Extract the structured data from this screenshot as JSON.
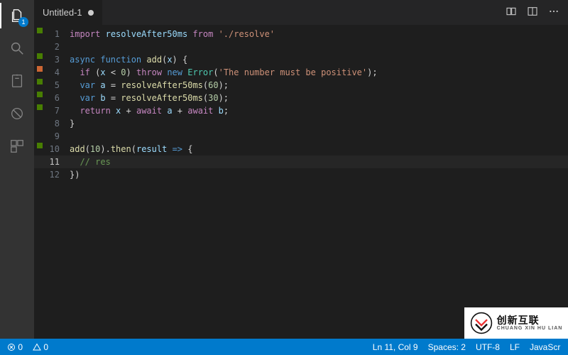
{
  "tab": {
    "title": "Untitled-1",
    "dirty": true
  },
  "activity": {
    "explorer_badge": "1"
  },
  "code": {
    "l1": {
      "n": "1"
    },
    "l2": {
      "n": "2"
    },
    "l3": {
      "n": "3"
    },
    "l4": {
      "n": "4"
    },
    "l5": {
      "n": "5"
    },
    "l6": {
      "n": "6"
    },
    "l7": {
      "n": "7"
    },
    "l8": {
      "n": "8"
    },
    "l9": {
      "n": "9"
    },
    "l10": {
      "n": "10"
    },
    "l11": {
      "n": "11"
    },
    "l12": {
      "n": "12"
    },
    "tok": {
      "import": "import",
      "resolveAfter50ms": "resolveAfter50ms",
      "from": "from",
      "resolve_path": "'./resolve'",
      "async": "async",
      "function": "function",
      "add": "add",
      "x": "x",
      "if": "if",
      "lt0": "0",
      "throw": "throw",
      "new": "new",
      "Error": "Error",
      "err_str": "'The number must be positive'",
      "var": "var",
      "a": "a",
      "b": "b",
      "sixty": "60",
      "thirty": "30",
      "return": "return",
      "await": "await",
      "ten": "10",
      "then": "then",
      "result": "result",
      "res_comment": "// res",
      "close": "})"
    }
  },
  "status": {
    "errors": "0",
    "warnings": "0",
    "ln_col": "Ln 11, Col 9",
    "spaces": "Spaces: 2",
    "encoding": "UTF-8",
    "eol": "LF",
    "lang": "JavaScript"
  },
  "watermark": {
    "brand": "创新互联",
    "pinyin": "CHUANG XIN HU LIAN"
  }
}
